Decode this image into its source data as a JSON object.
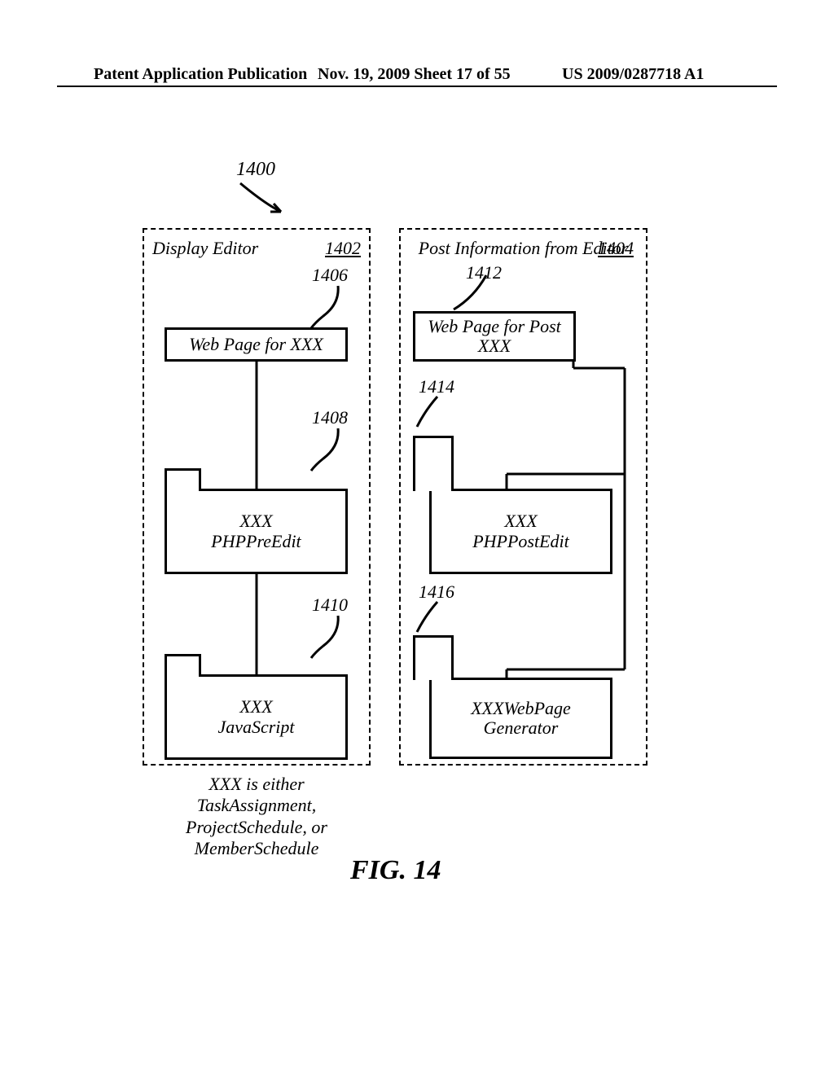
{
  "header": {
    "left": "Patent Application Publication",
    "mid": "Nov. 19, 2009  Sheet 17 of 55",
    "right": "US 2009/0287718 A1"
  },
  "ref_1400": "1400",
  "left_group": {
    "title": "Display Editor",
    "ref": "1402",
    "ref_1406": "1406",
    "comp_1406": "Web Page for XXX",
    "ref_1408": "1408",
    "comp_1408_line1": "XXX",
    "comp_1408_line2": "PHPPreEdit",
    "ref_1410": "1410",
    "comp_1410_line1": "XXX",
    "comp_1410_line2": "JavaScript"
  },
  "right_group": {
    "title": "Post Information from Editor",
    "ref": "1404",
    "ref_1412": "1412",
    "comp_1412_line1": "Web Page for Post",
    "comp_1412_line2": "XXX",
    "ref_1414": "1414",
    "comp_1414_line1": "XXX",
    "comp_1414_line2": "PHPPostEdit",
    "ref_1416": "1416",
    "comp_1416_line1": "XXXWebPage",
    "comp_1416_line2": "Generator"
  },
  "footnote_line1": "XXX is either",
  "footnote_line2": "TaskAssignment,",
  "footnote_line3": "ProjectSchedule, or",
  "footnote_line4": "MemberSchedule",
  "figure_label": "FIG. 14"
}
